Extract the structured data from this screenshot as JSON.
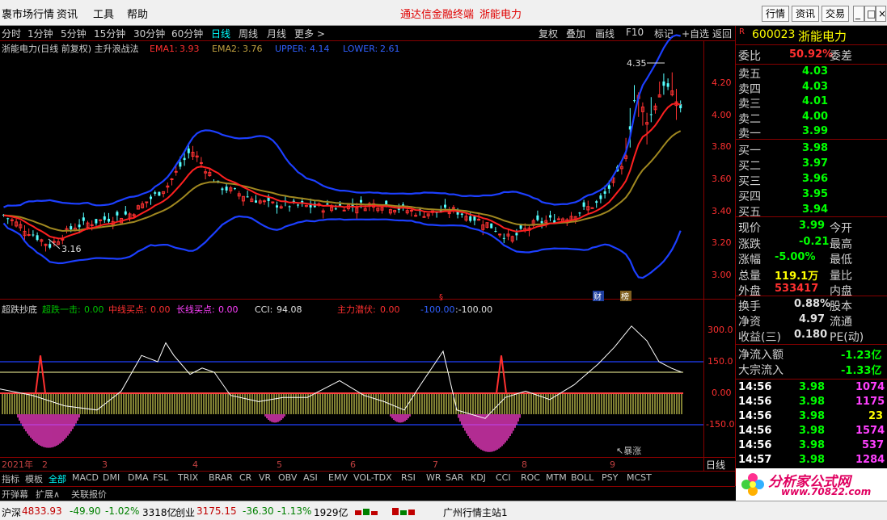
{
  "topbar": {
    "left_title": "褢市场行情",
    "menu": [
      "资讯",
      "工具",
      "帮助"
    ],
    "brand": "通达信金融终端",
    "stock_title": "浙能电力",
    "right_buttons": [
      "行情",
      "资讯",
      "交易"
    ],
    "window_buttons": [
      "_",
      "□",
      "×"
    ]
  },
  "period_bar": {
    "periods": [
      "分时",
      "1分钟",
      "5分钟",
      "15分钟",
      "30分钟",
      "60分钟",
      "日线",
      "周线",
      "月线",
      "更多 >"
    ],
    "active": "日线",
    "tools": [
      "复权",
      "叠加",
      "画线",
      "F10",
      "标记",
      "+自选",
      "返回"
    ]
  },
  "main_legend": {
    "name": "浙能电力(日线 前复权) 主升浪战法",
    "ema1_label": "EMA1:",
    "ema1": "3.93",
    "ema2_label": "EMA2:",
    "ema2": "3.76",
    "upper_label": "UPPER:",
    "upper": "4.14",
    "lower_label": "LOWER:",
    "lower": "2.61"
  },
  "price_axis": [
    "4.20",
    "4.00",
    "3.80",
    "3.60",
    "3.40",
    "3.20",
    "3.00"
  ],
  "annotations": {
    "high": "4.35",
    "low": "3.16",
    "cai": "财",
    "bang": "榜"
  },
  "sub_legend": {
    "name": "超跌抄底",
    "a_label": "超跌一击:",
    "a": "0.00",
    "b_label": "中线买点:",
    "b": "0.00",
    "c_label": "长线买点:",
    "c": "0.00",
    "d_label": "CCI:",
    "d": "94.08",
    "e_label": "主力潜伏:",
    "e": "0.00",
    "f": "-100.00",
    "g": ":-100.00"
  },
  "sub_axis": [
    "300.0",
    "150.0",
    "0.00",
    "-150.0"
  ],
  "sub_note": "↖暴涨",
  "date_axis": [
    "2021年",
    "2",
    "3",
    "4",
    "5",
    "6",
    "7",
    "8",
    "9"
  ],
  "period_label": "日线",
  "indicator_tabs": [
    "指标",
    "模板",
    "全部",
    "MACD",
    "DMI",
    "DMA",
    "FSL",
    "TRIX",
    "BRAR",
    "CR",
    "VR",
    "OBV",
    "ASI",
    "EMV",
    "VOL-TDX",
    "RSI",
    "WR",
    "SAR",
    "KDJ",
    "CCI",
    "ROC",
    "MTM",
    "BOLL",
    "PSY",
    "MCST"
  ],
  "bottom_links": [
    "开弹幕",
    "扩展∧",
    "关联报价"
  ],
  "quote": {
    "code": "600023",
    "name": "浙能电力",
    "weibi_label": "委比",
    "weibi": "50.92%",
    "weicha_label": "委差",
    "sells": [
      {
        "label": "卖五",
        "price": "4.03"
      },
      {
        "label": "卖四",
        "price": "4.03"
      },
      {
        "label": "卖三",
        "price": "4.01"
      },
      {
        "label": "卖二",
        "price": "4.00"
      },
      {
        "label": "卖一",
        "price": "3.99"
      }
    ],
    "buys": [
      {
        "label": "买一",
        "price": "3.98"
      },
      {
        "label": "买二",
        "price": "3.97"
      },
      {
        "label": "买三",
        "price": "3.96"
      },
      {
        "label": "买四",
        "price": "3.95"
      },
      {
        "label": "买五",
        "price": "3.94"
      }
    ],
    "stats": [
      {
        "l": "现价",
        "v": "3.99",
        "r": "今开"
      },
      {
        "l": "涨跌",
        "v": "-0.21",
        "r": "最高"
      },
      {
        "l": "涨幅",
        "v": "-5.00%",
        "r": "最低"
      },
      {
        "l": "总量",
        "v": "119.1万",
        "r": "量比"
      },
      {
        "l": "外盘",
        "v": "533417",
        "r": "内盘"
      }
    ],
    "finance": [
      {
        "l": "换手",
        "v": "0.88%",
        "r": "股本"
      },
      {
        "l": "净资",
        "v": "4.97",
        "r": "流通"
      },
      {
        "l": "收益(三)",
        "v": "0.180",
        "r": "PE(动)"
      }
    ],
    "flows": [
      {
        "l": "净流入额",
        "v": "-1.23亿"
      },
      {
        "l": "大宗流入",
        "v": "-1.33亿"
      }
    ],
    "ticks": [
      {
        "t": "14:56",
        "p": "3.98",
        "v": "1074"
      },
      {
        "t": "14:56",
        "p": "3.98",
        "v": "1175"
      },
      {
        "t": "14:56",
        "p": "3.98",
        "v": "23"
      },
      {
        "t": "14:56",
        "p": "3.98",
        "v": "1574"
      },
      {
        "t": "14:56",
        "p": "3.98",
        "v": "537"
      },
      {
        "t": "14:57",
        "p": "3.98",
        "v": "1284"
      }
    ]
  },
  "watermark": "分析家公式网www.70822.com",
  "logo": {
    "text": "分析家公式网",
    "url": "www.70822.com"
  },
  "status": {
    "sh_label": "沪深",
    "sh_val": "4833.93",
    "sh_chg": "-49.90",
    "sh_pct": "-1.02%",
    "sh_amt": "3318亿",
    "cy_label": "创业",
    "cy_val": "3175.15",
    "cy_chg": "-36.30",
    "cy_pct": "-1.13%",
    "cy_amt": "1929亿",
    "server": "广州行情主站1"
  },
  "colors": {
    "up": "#ff3232",
    "down": "#54ffff",
    "boll": "#1c3fff",
    "ema1": "#ff2020",
    "ema2": "#a08820",
    "sub_yellow": "#ffff66",
    "sub_pink": "#ff3fd0"
  }
}
